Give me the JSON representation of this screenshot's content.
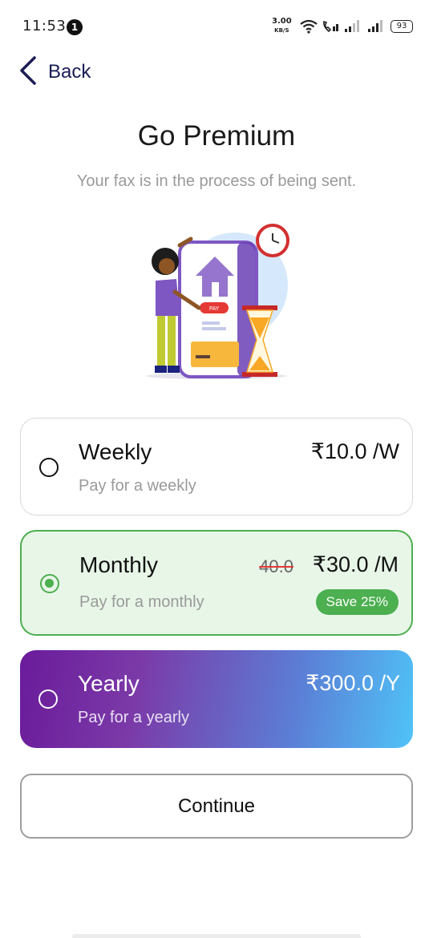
{
  "status_bar": {
    "time": "11:53",
    "notification_count": "1",
    "net_speed": "3.00",
    "net_speed_unit": "KB/S",
    "battery": "93"
  },
  "header": {
    "back_label": "Back",
    "title": "Go Premium",
    "subtitle": "Your fax is in the process of being sent."
  },
  "illustration": {
    "pay_label": "PAY"
  },
  "plans": [
    {
      "name": "Weekly",
      "description": "Pay for a weekly",
      "price": "₹10.0 /W",
      "selected": false
    },
    {
      "name": "Monthly",
      "description": "Pay for a monthly",
      "price": "₹30.0 /M",
      "old_price": "40.0",
      "badge": "Save 25%",
      "selected": true
    },
    {
      "name": "Yearly",
      "description": "Pay for a yearly",
      "price": "₹300.0 /Y",
      "selected": false
    }
  ],
  "continue_label": "Continue",
  "colors": {
    "accent_green": "#4caf50",
    "selected_bg": "#e8f6e8",
    "gradient_start": "#6a1b9a",
    "gradient_end": "#4fc3f7",
    "back_color": "#1a1d55"
  }
}
